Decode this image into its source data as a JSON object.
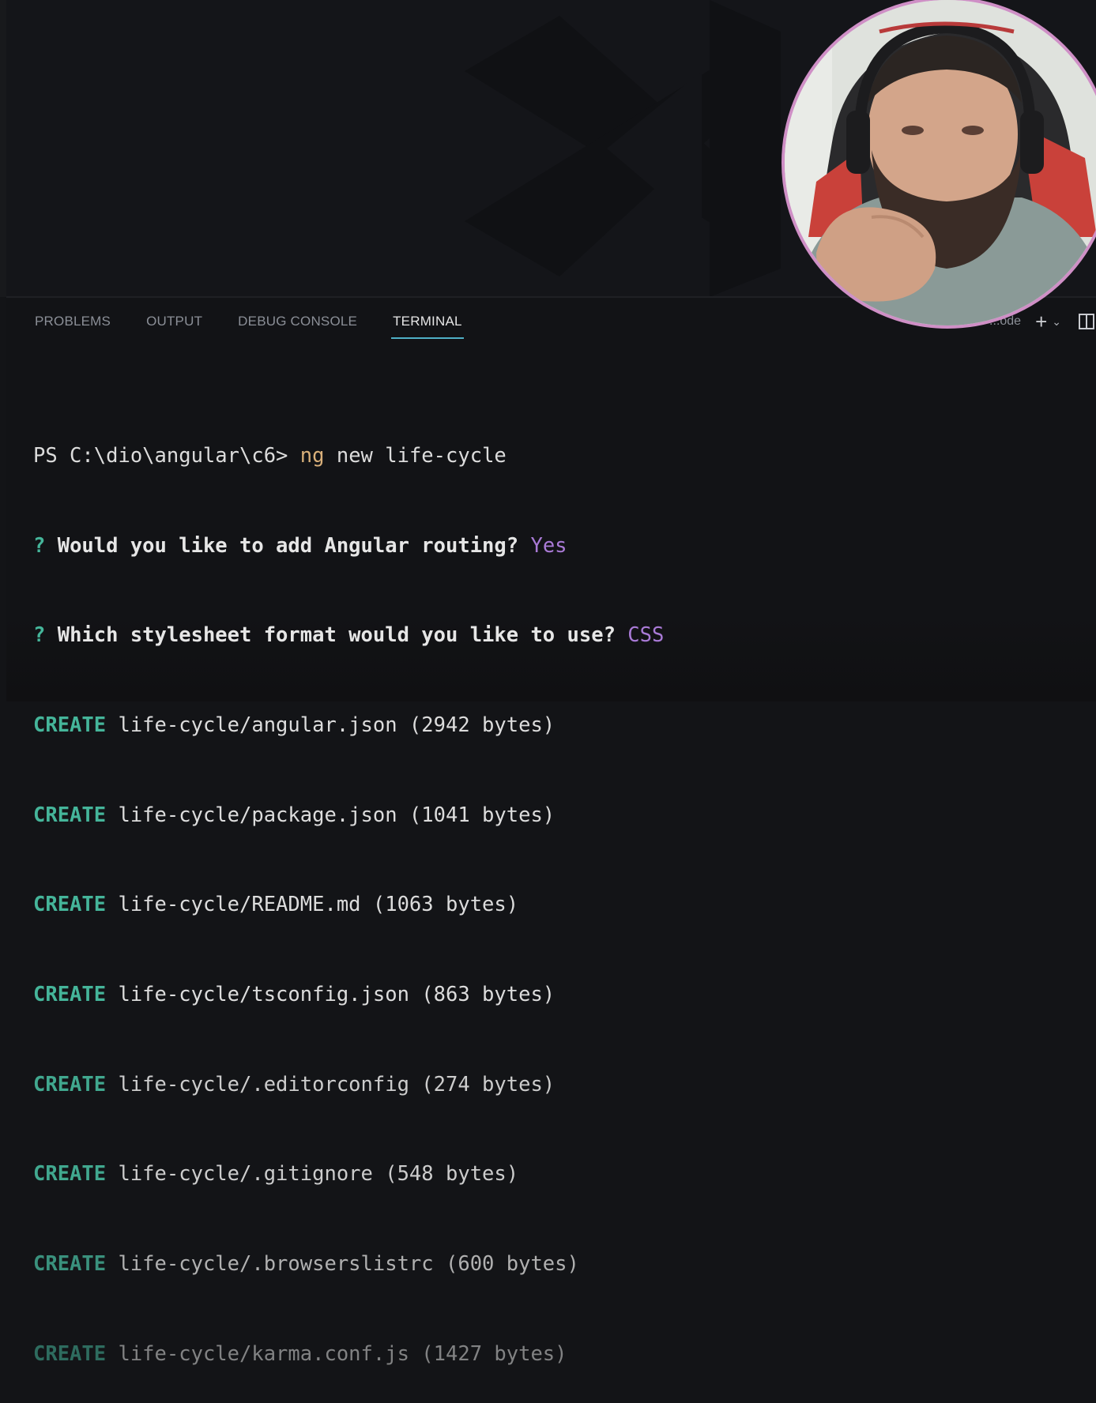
{
  "panel": {
    "tabs": [
      {
        "label": "PROBLEMS",
        "active": false
      },
      {
        "label": "OUTPUT",
        "active": false
      },
      {
        "label": "DEBUG CONSOLE",
        "active": false
      },
      {
        "label": "TERMINAL",
        "active": true
      }
    ],
    "actions": {
      "shell_label": "...ode",
      "add_icon": "plus-icon",
      "dropdown_icon": "chevron-down-icon",
      "split_icon": "split-editor-icon"
    }
  },
  "terminal": {
    "prompt": "PS C:\\dio\\angular\\c6> ",
    "command_keyword": "ng",
    "command_rest": " new life-cycle",
    "questions": [
      {
        "mark": "? ",
        "text": "Would you like to add Angular routing?",
        "answer": " Yes"
      },
      {
        "mark": "? ",
        "text": "Which stylesheet format would you like to use?",
        "answer": " CSS"
      }
    ],
    "create_label": "CREATE",
    "created_files": [
      " life-cycle/angular.json (2942 bytes)",
      " life-cycle/package.json (1041 bytes)",
      " life-cycle/README.md (1063 bytes)",
      " life-cycle/tsconfig.json (863 bytes)",
      " life-cycle/.editorconfig (274 bytes)",
      " life-cycle/.gitignore (548 bytes)",
      " life-cycle/.browserslistrc (600 bytes)",
      " life-cycle/karma.conf.js (1427 bytes)"
    ]
  },
  "colors": {
    "background": "#131417",
    "active_tab_underline": "#4fb0c6",
    "create": "#45b59a",
    "answer": "#a97ad6",
    "ng_command": "#d9b07a",
    "webcam_border": "#cf8fc6"
  }
}
